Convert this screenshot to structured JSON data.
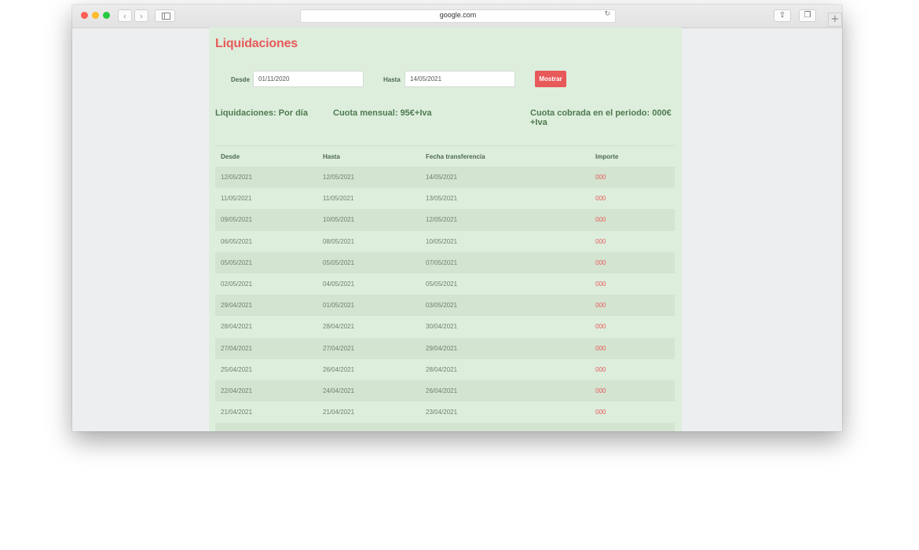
{
  "browser": {
    "url": "google.com",
    "icons": {
      "back": "chevron-left-icon",
      "forward": "chevron-right-icon",
      "sidebar": "sidebar-icon",
      "reload": "reload-icon",
      "share": "share-icon",
      "tabs": "tabs-icon",
      "new_tab": "plus-icon"
    }
  },
  "page": {
    "title": "Liquidaciones",
    "filters": {
      "desde_label": "Desde",
      "desde_value": "01/11/2020",
      "hasta_label": "Hasta",
      "hasta_value": "14/05/2021",
      "button_label": "Mostrar"
    },
    "summary": {
      "liquidaciones": "Liquidaciones: Por día",
      "cuota_mensual": "Cuota mensual: 95€+Iva",
      "cuota_cobrada": "Cuota cobrada en el periodo: 000€+Iva"
    },
    "table": {
      "headers": [
        "Desde",
        "Hasta",
        "Fecha transferencia",
        "Importe"
      ],
      "rows": [
        [
          "12/05/2021",
          "12/05/2021",
          "14/05/2021",
          "000"
        ],
        [
          "11/05/2021",
          "11/05/2021",
          "13/05/2021",
          "000"
        ],
        [
          "09/05/2021",
          "10/05/2021",
          "12/05/2021",
          "000"
        ],
        [
          "06/05/2021",
          "08/05/2021",
          "10/05/2021",
          "000"
        ],
        [
          "05/05/2021",
          "05/05/2021",
          "07/05/2021",
          "000"
        ],
        [
          "02/05/2021",
          "04/05/2021",
          "05/05/2021",
          "000"
        ],
        [
          "29/04/2021",
          "01/05/2021",
          "03/05/2021",
          "000"
        ],
        [
          "28/04/2021",
          "28/04/2021",
          "30/04/2021",
          "000"
        ],
        [
          "27/04/2021",
          "27/04/2021",
          "29/04/2021",
          "000"
        ],
        [
          "25/04/2021",
          "26/04/2021",
          "28/04/2021",
          "000"
        ],
        [
          "22/04/2021",
          "24/04/2021",
          "26/04/2021",
          "000"
        ],
        [
          "21/04/2021",
          "21/04/2021",
          "23/04/2021",
          "000"
        ],
        [
          "",
          "",
          "",
          ""
        ]
      ]
    },
    "colors": {
      "accent": "#e85a5a",
      "content_bg": "#ddeedd",
      "stripe_bg": "#d3e4d0",
      "heading_green": "#4e7a4e"
    }
  }
}
